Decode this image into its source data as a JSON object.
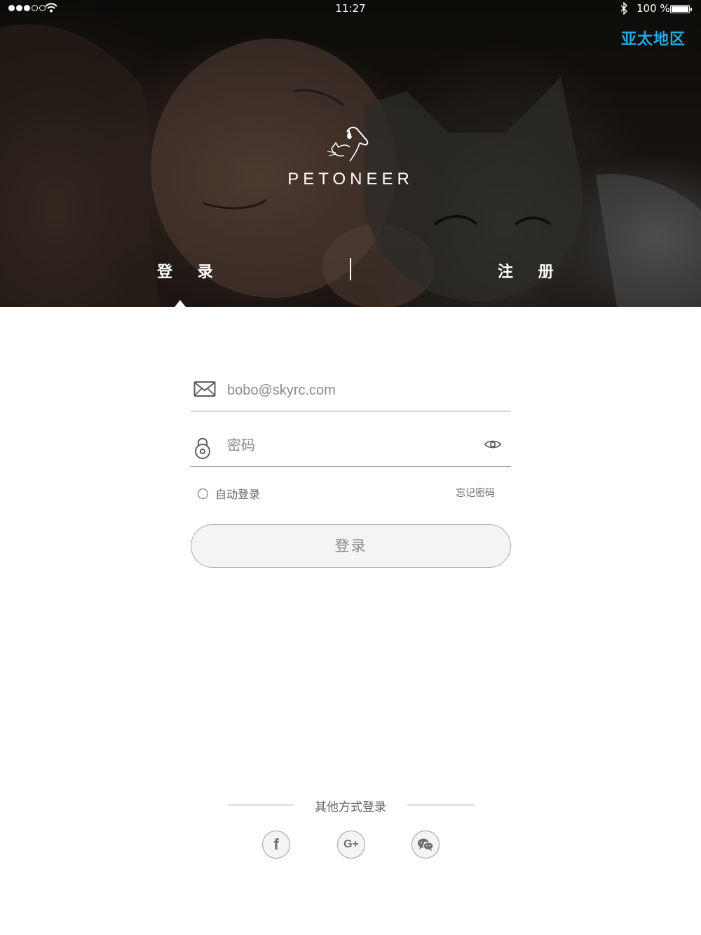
{
  "status_bar": {
    "time": "11:27",
    "battery": "100 %",
    "signal_icon": "signal-dots-icon",
    "wifi_icon": "wifi-icon",
    "bluetooth_icon": "bluetooth-icon"
  },
  "header": {
    "region": "亚太地区",
    "brand": "PETONEER",
    "logo_icon": "petoneer-cat-dog-logo"
  },
  "tabs": {
    "login": "登 录",
    "register": "注 册",
    "active": "login"
  },
  "form": {
    "email": {
      "value": "",
      "placeholder": "bobo@skyrc.com",
      "icon": "mail-icon"
    },
    "password": {
      "value": "",
      "placeholder": "密码",
      "icon": "lock-icon",
      "toggle_icon": "eye-icon"
    },
    "auto_login": "自动登录",
    "forgot_password": "忘记密码",
    "submit": "登录"
  },
  "other_login": {
    "label": "其他方式登录",
    "providers": [
      {
        "name": "facebook",
        "glyph": "f"
      },
      {
        "name": "google-plus",
        "glyph": "G+"
      },
      {
        "name": "wechat",
        "glyph": "wechat-icon"
      }
    ]
  },
  "colors": {
    "accent": "#27a7df",
    "border": "#9aa3aa",
    "button_bg": "#f4f4f7"
  }
}
